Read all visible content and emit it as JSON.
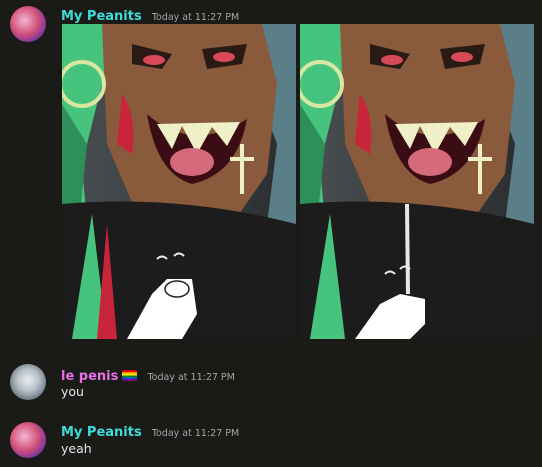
{
  "messages": [
    {
      "username": "My Peanits",
      "timestamp": "Today at 11:27 PM",
      "attachments": [
        "artwork image 1",
        "artwork image 2"
      ]
    },
    {
      "username": "le penis",
      "badge_icon": "pride-flag-icon",
      "timestamp": "Today at 11:27 PM",
      "text": "you"
    },
    {
      "username": "My Peanits",
      "timestamp": "Today at 11:27 PM",
      "text": "yeah"
    }
  ],
  "colors": {
    "background": "#1a1a17",
    "peanits_name": "#3ddbd9",
    "penis_name": "#e66ee8",
    "timestamp": "#a3a6aa"
  }
}
